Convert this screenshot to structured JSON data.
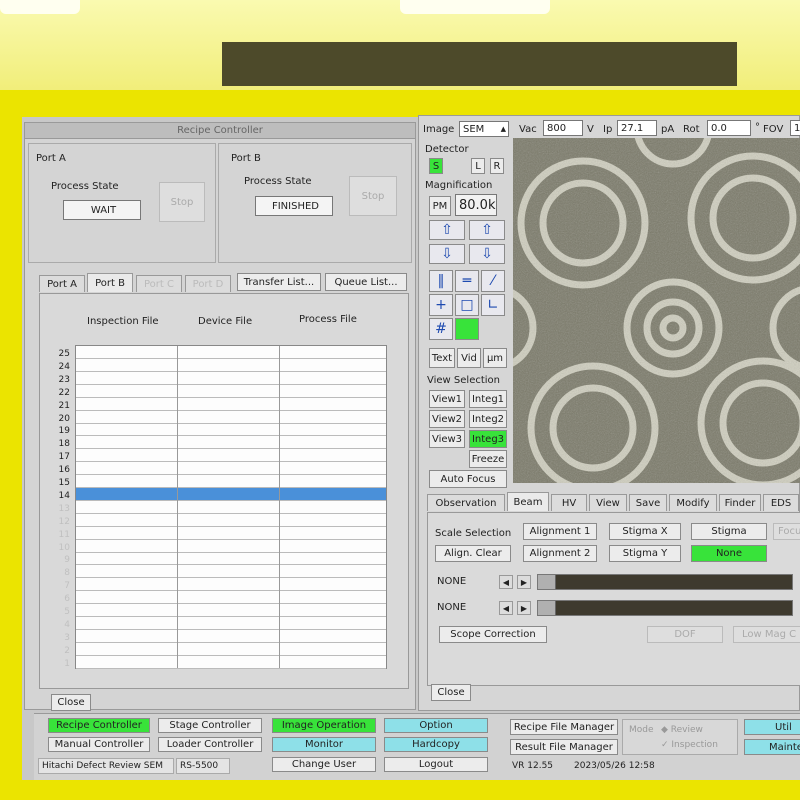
{
  "recipe_controller": {
    "title": "Recipe Controller",
    "port_a": {
      "label": "Port A",
      "process_state_label": "Process State",
      "state": "WAIT",
      "stop_label": "Stop"
    },
    "port_b": {
      "label": "Port B",
      "process_state_label": "Process State",
      "state": "FINISHED",
      "stop_label": "Stop"
    },
    "tabs": [
      "Port A",
      "Port B",
      "Port C",
      "Port D"
    ],
    "transfer_list_label": "Transfer List...",
    "queue_list_label": "Queue List...",
    "columns": [
      "Inspection File",
      "Device File",
      "Process File"
    ],
    "rows": [
      "25",
      "24",
      "23",
      "22",
      "21",
      "20",
      "19",
      "18",
      "17",
      "16",
      "15",
      "14",
      "13",
      "12",
      "11",
      "10",
      "9",
      "8",
      "7",
      "6",
      "5",
      "4",
      "3",
      "2",
      "1"
    ],
    "selected_row": "14",
    "close_label": "Close"
  },
  "image_panel": {
    "image_label": "Image",
    "image_mode": "SEM",
    "vac_label": "Vac",
    "vac_value": "800",
    "vac_unit": "V",
    "ip_label": "Ip",
    "ip_value": "27.1",
    "ip_unit": "pA",
    "rot_label": "Rot",
    "rot_value": "0.0",
    "rot_unit": "°",
    "fov_label": "FOV",
    "fov_value": "1",
    "detector_label": "Detector",
    "detector_s": "S",
    "detector_l": "L",
    "detector_r": "R",
    "magnification_label": "Magnification",
    "pm_label": "PM",
    "magnification_value": "80.0k",
    "text_label": "Text",
    "vid_label": "Vid",
    "um_label": "µm",
    "view_selection_label": "View Selection",
    "view1": "View1",
    "view2": "View2",
    "view3": "View3",
    "integ1": "Integ1",
    "integ2": "Integ2",
    "integ3": "Integ3",
    "freeze_label": "Freeze",
    "auto_focus_label": "Auto Focus",
    "tabs": [
      "Observation",
      "Beam",
      "HV",
      "View",
      "Save",
      "Modify",
      "Finder",
      "EDS"
    ],
    "scale_selection_label": "Scale Selection",
    "alignment1": "Alignment 1",
    "alignment2": "Alignment 2",
    "stigma_x": "Stigma X",
    "stigma_y": "Stigma Y",
    "stigma": "Stigma",
    "none_button": "None",
    "focus_label": "Focus",
    "align_clear": "Align. Clear",
    "slider1_label": "NONE",
    "slider2_label": "NONE",
    "scope_correction": "Scope Correction",
    "dof_label": "DOF",
    "low_mag_label": "Low Mag C",
    "close_label": "Close"
  },
  "bottom_bar": {
    "recipe_controller": "Recipe Controller",
    "stage_controller": "Stage Controller",
    "image_operation": "Image Operation",
    "option": "Option",
    "manual_controller": "Manual Controller",
    "loader_controller": "Loader Controller",
    "monitor": "Monitor",
    "hardcopy": "Hardcopy",
    "change_user": "Change User",
    "logout": "Logout",
    "system_name": "Hitachi Defect Review SEM",
    "model": "RS-5500",
    "recipe_file_manager": "Recipe File Manager",
    "result_file_manager": "Result File Manager",
    "mode_label": "Mode",
    "mode_review": "Review",
    "mode_inspection": "Inspection",
    "util_label": "Util",
    "mainte_label": "Mainte",
    "version": "VR 12.55",
    "datetime": "2023/05/26 12:58"
  },
  "colors": {
    "active_green": "#38e33a",
    "cyan": "#8ee0e8",
    "selection_blue": "#4a90d9",
    "bezel_yellow": "#ebe400"
  }
}
